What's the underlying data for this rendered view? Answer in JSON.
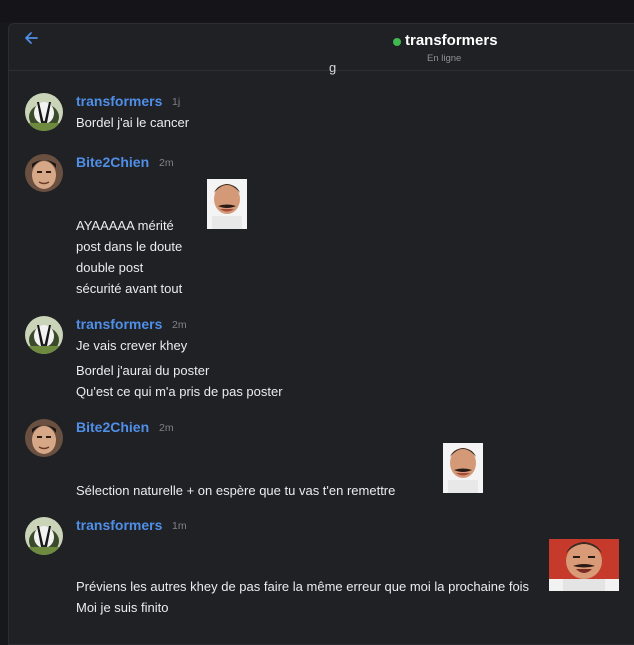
{
  "header": {
    "title": "transformers",
    "status": "En ligne",
    "back_icon": "arrow-left-icon",
    "status_color": "#3fb950",
    "accent_color": "#4f8fe8"
  },
  "cut_text": "g",
  "messages": [
    {
      "author": "transformers",
      "time": "1j",
      "avatar": "badger-avatar",
      "lines": [
        "Bordel j'ai le cancer"
      ]
    },
    {
      "author": "Bite2Chien",
      "time": "2m",
      "avatar": "face-avatar",
      "sticker": "risitas-sticker",
      "lines": [
        "AYAAAAA mérité",
        "post dans le doute",
        "double post",
        "sécurité avant tout"
      ]
    },
    {
      "author": "transformers",
      "time": "2m",
      "avatar": "badger-avatar",
      "lines": [
        "Je vais crever khey",
        "Bordel j'aurai du poster",
        "Qu'est ce qui m'a pris de pas poster"
      ]
    },
    {
      "author": "Bite2Chien",
      "time": "2m",
      "avatar": "face-avatar",
      "sticker": "risitas-sticker",
      "lines": [
        "Sélection naturelle + on espère que tu vas t'en remettre"
      ]
    },
    {
      "author": "transformers",
      "time": "1m",
      "avatar": "badger-avatar",
      "sticker": "risitas-laughing-sticker",
      "lines": [
        "Préviens les autres khey de pas faire la même erreur que moi la prochaine fois",
        "Moi je suis finito"
      ]
    }
  ]
}
